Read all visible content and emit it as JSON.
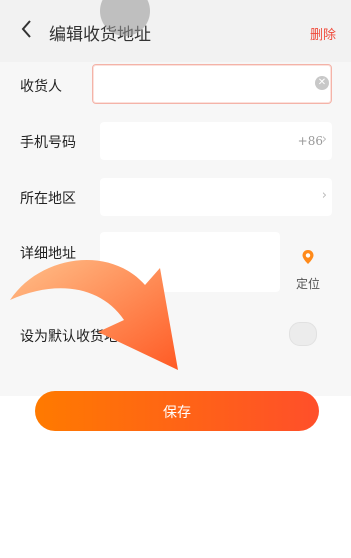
{
  "header": {
    "title": "编辑收货地址",
    "delete_label": "删除"
  },
  "form": {
    "receiver_label": "收货人",
    "receiver_value": "",
    "phone_label": "手机号码",
    "phone_prefix": "+86",
    "region_label": "所在地区",
    "address_label": "详细地址",
    "locate_label": "定位",
    "default_label": "设为默认收货地址"
  },
  "actions": {
    "save_label": "保存"
  },
  "icons": [
    "back-icon",
    "clear-icon",
    "chevron-right-icon",
    "location-pin-icon",
    "arrow-icon"
  ],
  "colors": {
    "accent": "#ff6a1a",
    "delete": "#f04a3a",
    "pin": "#ff8a1a"
  }
}
